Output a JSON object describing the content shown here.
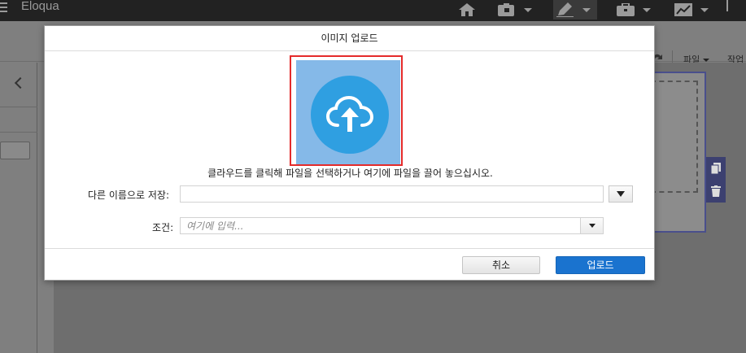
{
  "app": {
    "title": "Eloqua"
  },
  "topnav": {
    "items": [
      {
        "icon": "home-icon"
      },
      {
        "icon": "assets-icon"
      },
      {
        "icon": "pencil-icon"
      },
      {
        "icon": "briefcase-icon"
      },
      {
        "icon": "chart-icon"
      }
    ]
  },
  "toolbar": {
    "file_label": "파일",
    "actions_label": "작업"
  },
  "modal": {
    "title": "이미지 업로드",
    "instruction": "클라우드를 클릭해 파일을 선택하거나 여기에 파일을 끌어 놓으십시오.",
    "save_as_label": "다른 이름으로 저장:",
    "save_as_value": "",
    "condition_label": "조건:",
    "condition_placeholder": "여기에 입력...",
    "cancel_label": "취소",
    "upload_label": "업로드"
  },
  "colors": {
    "upload_tile": "#85b9e8",
    "upload_circle": "#2f9fe1",
    "highlight_frame": "#e42b2b",
    "primary_button": "#1a73cf"
  }
}
